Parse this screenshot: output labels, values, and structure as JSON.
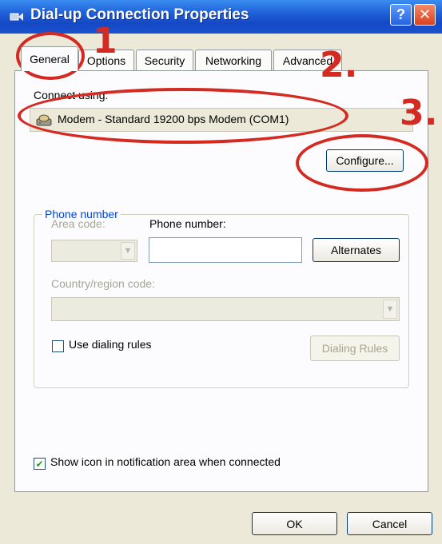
{
  "window": {
    "title": "Dial-up Connection Properties",
    "help_label": "?",
    "close_label": "✕"
  },
  "tabs": [
    {
      "label": "General"
    },
    {
      "label": "Options"
    },
    {
      "label": "Security"
    },
    {
      "label": "Networking"
    },
    {
      "label": "Advanced"
    }
  ],
  "general": {
    "connect_using_label": "Connect using:",
    "modem_name": "Modem - Standard 19200 bps Modem (COM1)",
    "configure_label": "Configure...",
    "phone_group_label": "Phone number",
    "area_code_label": "Area code:",
    "phone_number_label": "Phone number:",
    "phone_number_value": "",
    "alternates_label": "Alternates",
    "country_label": "Country/region code:",
    "use_dialing_rules_label": "Use dialing rules",
    "use_dialing_rules_checked": false,
    "dialing_rules_label": "Dialing Rules",
    "show_icon_label": "Show icon in notification area when connected",
    "show_icon_checked": true,
    "checkmark": "✔"
  },
  "footer": {
    "ok_label": "OK",
    "cancel_label": "Cancel"
  },
  "annotations": {
    "one": "1",
    "two": "2.",
    "three": "3."
  },
  "colors": {
    "annotation_red": "#d42a22",
    "titlebar_blue": "#1f5fd8",
    "group_title_blue": "#0046d5"
  }
}
